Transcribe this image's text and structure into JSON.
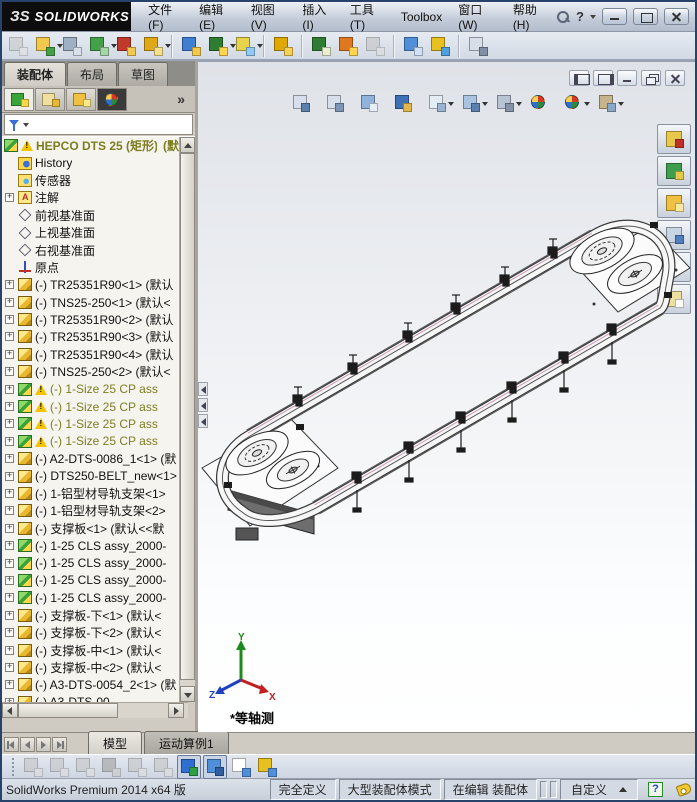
{
  "titlebar": {
    "brand_mark": "ЗS",
    "brand": "SOLIDWORKS",
    "menus": [
      "文件(F)",
      "编辑(E)",
      "视图(V)",
      "插入(I)",
      "工具(T)",
      "Toolbox",
      "窗口(W)",
      "帮助(H)"
    ],
    "help_glyph": "?"
  },
  "main_toolbar": {
    "items": [
      {
        "name": "edit-component",
        "c1": "#c6c6c6",
        "c2": "#e2e2e2",
        "disabled": true
      },
      {
        "name": "insert-component",
        "c1": "#f2c94c",
        "c2": "#43a047",
        "dd": true
      },
      {
        "name": "mate",
        "c1": "#9fb0c4",
        "c2": "#d9e0ea"
      },
      {
        "name": "linear-component-pattern",
        "c1": "#43a047",
        "c2": "#a5d6a7",
        "dd": true
      },
      {
        "name": "smart-fasteners",
        "c1": "#c0392b",
        "c2": "#f2c94c"
      },
      {
        "name": "move-component",
        "c1": "#e0a815",
        "c2": "#f7e08a",
        "dd": true
      },
      {
        "sep": true
      },
      {
        "name": "show-hidden-components",
        "c1": "#3f7fd2",
        "c2": "#f2c94c"
      },
      {
        "name": "assembly-features",
        "c1": "#2e7d32",
        "c2": "#ffd54f",
        "dd": true
      },
      {
        "name": "reference-geometry",
        "c1": "#e8d44a",
        "c2": "#90caf9",
        "dd": true
      },
      {
        "sep": true
      },
      {
        "name": "exploded-view",
        "c1": "#e0a800",
        "c2": "#f7d154"
      },
      {
        "sep": true
      },
      {
        "name": "isolate",
        "c1": "#2e7d32",
        "c2": "#e8f0d0"
      },
      {
        "name": "large-assembly-mode",
        "c1": "#e07820",
        "c2": "#ffd54f"
      },
      {
        "name": "simulation",
        "c1": "#c0c0c0",
        "c2": "#dddddd",
        "disabled": true
      },
      {
        "sep": true
      },
      {
        "name": "measure",
        "c1": "#4f8fd9",
        "c2": "#cfe2f7"
      },
      {
        "name": "interference-detection",
        "c1": "#e8c020",
        "c2": "#50a0e0"
      },
      {
        "sep": true
      },
      {
        "name": "assembly-xpert",
        "c1": "#d8dee8",
        "c2": "#8090a8"
      }
    ]
  },
  "left_panel": {
    "command_tabs": [
      {
        "label": "装配体",
        "active": true
      },
      {
        "label": "布局"
      },
      {
        "label": "草图"
      }
    ],
    "manager_tabs": [
      {
        "name": "featuremanager-tab",
        "c1": "#3aa33a",
        "c2": "#ffd84a",
        "active": true
      },
      {
        "name": "propertymanager-tab",
        "c1": "#f0e0a0",
        "c2": "#e8b830"
      },
      {
        "name": "configurationmanager-tab",
        "c1": "#f0c040",
        "c2": "#ffe98a"
      },
      {
        "name": "displaymanager-tab",
        "kind": "wheel"
      }
    ],
    "overflow_label": "»",
    "tree": {
      "root": {
        "label": "HEPCO DTS 25 (矩形)",
        "suffix": "(默"
      },
      "items": [
        {
          "icon": "history",
          "label": "History"
        },
        {
          "icon": "sensors",
          "label": "传感器"
        },
        {
          "icon": "annotations",
          "label": "注解",
          "expand": true
        },
        {
          "icon": "plane",
          "label": "前视基准面"
        },
        {
          "icon": "plane",
          "label": "上视基准面"
        },
        {
          "icon": "plane",
          "label": "右视基准面"
        },
        {
          "icon": "origin",
          "label": "原点"
        },
        {
          "icon": "part",
          "label": "(-) TR25351R90<1> (默认",
          "expand": true
        },
        {
          "icon": "part",
          "label": "(-) TNS25-250<1> (默认<",
          "expand": true
        },
        {
          "icon": "part",
          "label": "(-) TR25351R90<2> (默认",
          "expand": true
        },
        {
          "icon": "part",
          "label": "(-) TR25351R90<3> (默认",
          "expand": true
        },
        {
          "icon": "part",
          "label": "(-) TR25351R90<4> (默认",
          "expand": true
        },
        {
          "icon": "part",
          "label": "(-) TNS25-250<2> (默认<",
          "expand": true
        },
        {
          "icon": "assembly",
          "label": "(-) 1-Size 25 CP ass",
          "expand": true,
          "warn": true,
          "olive": true
        },
        {
          "icon": "assembly",
          "label": "(-) 1-Size 25 CP ass",
          "expand": true,
          "warn": true,
          "olive": true
        },
        {
          "icon": "assembly",
          "label": "(-) 1-Size 25 CP ass",
          "expand": true,
          "warn": true,
          "olive": true
        },
        {
          "icon": "assembly",
          "label": "(-) 1-Size 25 CP ass",
          "expand": true,
          "warn": true,
          "olive": true
        },
        {
          "icon": "part",
          "label": "(-) A2-DTS-0086_1<1> (默",
          "expand": true
        },
        {
          "icon": "part",
          "label": "(-) DTS250-BELT_new<1>",
          "expand": true
        },
        {
          "icon": "part",
          "label": "(-) 1-铝型材导轨支架<1>",
          "expand": true
        },
        {
          "icon": "part",
          "label": "(-) 1-铝型材导轨支架<2>",
          "expand": true
        },
        {
          "icon": "part",
          "label": "(-) 支撑板<1> (默认<<默",
          "expand": true
        },
        {
          "icon": "assembly",
          "label": "(-) 1-25 CLS assy_2000-",
          "expand": true
        },
        {
          "icon": "assembly",
          "label": "(-) 1-25 CLS assy_2000-",
          "expand": true
        },
        {
          "icon": "assembly",
          "label": "(-) 1-25 CLS assy_2000-",
          "expand": true
        },
        {
          "icon": "assembly",
          "label": "(-) 1-25 CLS assy_2000-",
          "expand": true
        },
        {
          "icon": "part",
          "label": "(-) 支撑板-下<1> (默认<",
          "expand": true
        },
        {
          "icon": "part",
          "label": "(-) 支撑板-下<2> (默认<",
          "expand": true
        },
        {
          "icon": "part",
          "label": "(-) 支撑板-中<1> (默认<",
          "expand": true
        },
        {
          "icon": "part",
          "label": "(-) 支撑板-中<2> (默认<",
          "expand": true
        },
        {
          "icon": "part",
          "label": "(-) A3-DTS-0054_2<1> (默",
          "expand": true
        },
        {
          "icon": "part",
          "label": "(-) A3-DTS-00",
          "expand": true
        }
      ]
    }
  },
  "viewport": {
    "hud": [
      {
        "name": "zoom-to-fit",
        "c1": "#d6dfeb",
        "c2": "#5b80b0"
      },
      {
        "name": "zoom-to-area",
        "c1": "#d6dfeb",
        "c2": "#7d95b5"
      },
      {
        "name": "previous-view",
        "c1": "#8fb3da",
        "c2": "#e6eef8"
      },
      {
        "name": "section-view",
        "c1": "#3f6fb5",
        "c2": "#e2b84a"
      },
      {
        "name": "view-orientation",
        "c1": "#e4ecf5",
        "c2": "#9ab3d0",
        "dd": true
      },
      {
        "name": "display-style",
        "c1": "#a8c4e0",
        "c2": "#5b80b0",
        "dd": true
      },
      {
        "name": "hide-show-items",
        "c1": "#b8c4d4",
        "c2": "#8593a8",
        "dd": true
      },
      {
        "name": "edit-appearance",
        "kind": "wheel"
      },
      {
        "name": "apply-scene",
        "kind": "wheel",
        "dd": true
      },
      {
        "name": "view-settings",
        "c1": "#c8b48a",
        "c2": "#8aa8c8",
        "dd": true
      }
    ],
    "task_pane": [
      {
        "name": "solidworks-resources",
        "c1": "#e8c84a",
        "c2": "#c03028"
      },
      {
        "name": "design-library",
        "c1": "#3f9e4d",
        "c2": "#e8c84a"
      },
      {
        "name": "file-explorer",
        "c1": "#f0c040",
        "c2": "#f8e8a0"
      },
      {
        "name": "view-palette",
        "c1": "#c8d4e4",
        "c2": "#4f7fbf"
      },
      {
        "name": "appearances-scenes",
        "kind": "wheel"
      },
      {
        "name": "custom-properties",
        "c1": "#f0e0a0",
        "c2": "#ffffff"
      }
    ],
    "view_label": "*等轴测",
    "triad": {
      "x": "X",
      "y": "Y",
      "z": "Z"
    }
  },
  "bottom_bar": {
    "tabs": [
      {
        "label": "模型",
        "active": true
      },
      {
        "label": "运动算例1"
      }
    ]
  },
  "lower_toolbar": {
    "items": [
      {
        "name": "mass-properties",
        "c1": "#c2c2c2",
        "c2": "#dedede",
        "disabled": true
      },
      {
        "name": "section-properties",
        "c1": "#c2c2c2",
        "c2": "#dedede",
        "disabled": true
      },
      {
        "name": "statistics",
        "c1": "#c2c2c2",
        "c2": "#dedede",
        "disabled": true
      },
      {
        "name": "equations",
        "c1": "#9a9a9a",
        "c2": "#c6c6c6",
        "disabled": true
      },
      {
        "name": "grid-snap",
        "c1": "#c2c2c2",
        "c2": "#dedede",
        "disabled": true
      },
      {
        "name": "reload",
        "c1": "#c2c2c2",
        "c2": "#dedede",
        "disabled": true
      },
      {
        "name": "coordinate-system",
        "c1": "#2f6fd0",
        "c2": "#2f9e44",
        "pressed": true
      },
      {
        "name": "shaded-view",
        "c1": "#4f8fd9",
        "c2": "#2f5fa0",
        "pressed": true
      },
      {
        "name": "design-table",
        "c1": "#ffffff",
        "c2": "#4f8fd9"
      },
      {
        "name": "save-reminder",
        "c1": "#e8c020",
        "c2": "#4f8fd9"
      }
    ]
  },
  "status_bar": {
    "product": "SolidWorks Premium 2014 x64 版",
    "define_state": "完全定义",
    "assembly_mode": "大型装配体模式",
    "editing": "在编辑 装配体",
    "custom": "自定义",
    "help_glyph": "?"
  }
}
